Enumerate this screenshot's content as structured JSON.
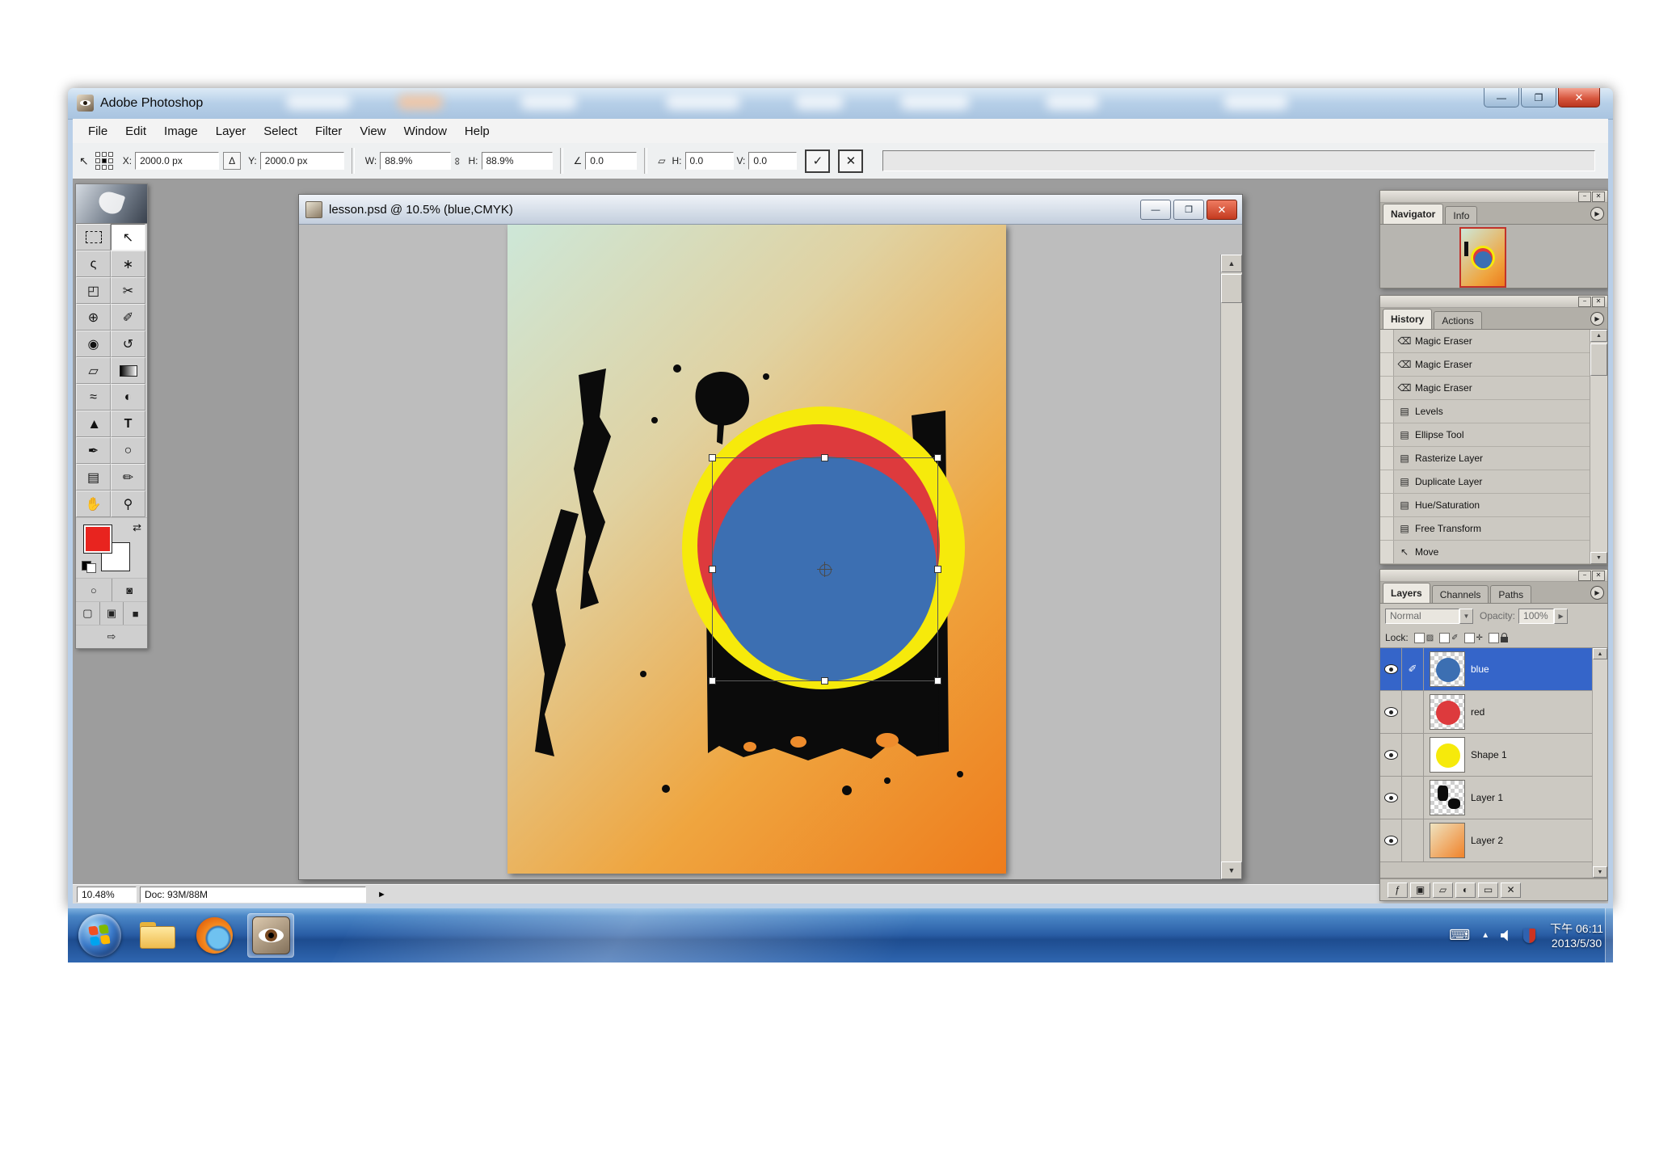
{
  "app": {
    "title": "Adobe Photoshop"
  },
  "menu": {
    "items": [
      "File",
      "Edit",
      "Image",
      "Layer",
      "Select",
      "Filter",
      "View",
      "Window",
      "Help"
    ]
  },
  "options": {
    "x_label": "X:",
    "x_value": "2000.0 px",
    "delta_glyph": "Δ",
    "y_label": "Y:",
    "y_value": "2000.0 px",
    "w_label": "W:",
    "w_value": "88.9%",
    "link_glyph": "∞",
    "h_label": "H:",
    "h_value": "88.9%",
    "rotate_glyph": "∠",
    "rotate_value": "0.0",
    "skew_glyph": "▱",
    "skew_h_label": "H:",
    "skew_h_value": "0.0",
    "skew_v_label": "V:",
    "skew_v_value": "0.0",
    "commit_glyph": "✓",
    "cancel_glyph": "✕",
    "move_tool_glyph": "↖"
  },
  "toolbox": {
    "tools": [
      {
        "name": "rectangular-marquee",
        "glyph": ""
      },
      {
        "name": "move",
        "glyph": "↖"
      },
      {
        "name": "lasso",
        "glyph": "ς"
      },
      {
        "name": "magic-wand",
        "glyph": "∗"
      },
      {
        "name": "crop",
        "glyph": "◰"
      },
      {
        "name": "slice",
        "glyph": "✂"
      },
      {
        "name": "healing-brush",
        "glyph": "⊕"
      },
      {
        "name": "brush",
        "glyph": "✐"
      },
      {
        "name": "clone-stamp",
        "glyph": "◉"
      },
      {
        "name": "history-brush",
        "glyph": "↺"
      },
      {
        "name": "eraser",
        "glyph": "▱"
      },
      {
        "name": "gradient",
        "glyph": ""
      },
      {
        "name": "blur",
        "glyph": "≈"
      },
      {
        "name": "dodge",
        "glyph": "◐"
      },
      {
        "name": "path-selection",
        "glyph": "▶"
      },
      {
        "name": "type",
        "glyph": "T"
      },
      {
        "name": "pen",
        "glyph": "✒"
      },
      {
        "name": "shape",
        "glyph": "○"
      },
      {
        "name": "notes",
        "glyph": "▤"
      },
      {
        "name": "eyedropper",
        "glyph": "✏"
      },
      {
        "name": "hand",
        "glyph": "✋"
      },
      {
        "name": "zoom",
        "glyph": "⚲"
      }
    ],
    "quickmask": [
      "○",
      "◙"
    ],
    "screenmode": [
      "▢",
      "▣",
      "■"
    ],
    "imageready_glyph": "⇨",
    "swap_glyph": "⇄",
    "foreground_color": "#e8241f",
    "background_color": "#ffffff"
  },
  "document": {
    "title": "lesson.psd @ 10.5% (blue,CMYK)"
  },
  "canvas_colors": {
    "yellow": "#f6ea0b",
    "red": "#dd3a3d",
    "blue": "#3c6fb2",
    "gradient_top_left": "#cde7d8",
    "gradient_bottom_right": "#ee7c1c"
  },
  "status": {
    "zoom": "10.48%",
    "doc_size": "Doc: 93M/88M",
    "flyout_glyph": "►"
  },
  "navigator": {
    "tabs": [
      "Navigator",
      "Info"
    ]
  },
  "history": {
    "tabs": [
      "History",
      "Actions"
    ],
    "items": [
      {
        "icon": "⌫",
        "label": "Magic Eraser"
      },
      {
        "icon": "⌫",
        "label": "Magic Eraser"
      },
      {
        "icon": "⌫",
        "label": "Magic Eraser"
      },
      {
        "icon": "▤",
        "label": "Levels"
      },
      {
        "icon": "▤",
        "label": "Ellipse Tool"
      },
      {
        "icon": "▤",
        "label": "Rasterize Layer"
      },
      {
        "icon": "▤",
        "label": "Duplicate Layer"
      },
      {
        "icon": "▤",
        "label": "Hue/Saturation"
      },
      {
        "icon": "▤",
        "label": "Free Transform"
      },
      {
        "icon": "↖",
        "label": "Move"
      }
    ]
  },
  "layers": {
    "tabs": [
      "Layers",
      "Channels",
      "Paths"
    ],
    "blend_mode": "Normal",
    "opacity_label": "Opacity:",
    "opacity_value": "100%",
    "lock_label": "Lock:",
    "selected": "blue",
    "items": [
      {
        "name": "blue"
      },
      {
        "name": "red"
      },
      {
        "name": "Shape 1"
      },
      {
        "name": "Layer 1"
      },
      {
        "name": "Layer 2"
      }
    ]
  },
  "taskbar": {
    "time": "下午 06:11",
    "date": "2013/5/30"
  }
}
